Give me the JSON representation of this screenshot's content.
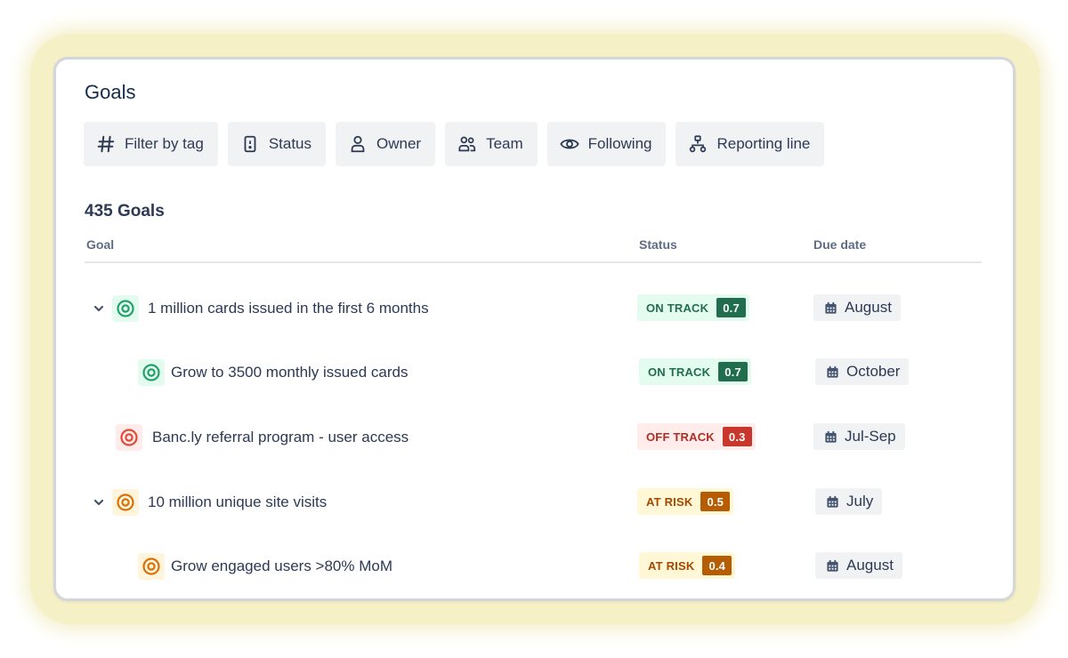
{
  "page": {
    "title": "Goals"
  },
  "filters": [
    {
      "label": "Filter by tag",
      "icon": "hash-icon"
    },
    {
      "label": "Status",
      "icon": "status-icon"
    },
    {
      "label": "Owner",
      "icon": "person-icon"
    },
    {
      "label": "Team",
      "icon": "team-icon"
    },
    {
      "label": "Following",
      "icon": "eye-icon"
    },
    {
      "label": "Reporting line",
      "icon": "hierarchy-icon"
    }
  ],
  "list": {
    "count_label": "435 Goals",
    "columns": {
      "goal": "Goal",
      "status": "Status",
      "due": "Due date"
    }
  },
  "colors": {
    "on_track_bg": "#e3fcef",
    "on_track_text": "#216e4e",
    "on_track_score": "#216e4e",
    "off_track_bg": "#ffeceb",
    "off_track_text": "#ae2e24",
    "off_track_score": "#c9372c",
    "at_risk_bg": "#fff7d6",
    "at_risk_text": "#a54800",
    "at_risk_score": "#b65c02",
    "green_icon": "#22a06b",
    "red_icon": "#e34935",
    "orange_icon": "#d97008"
  },
  "goals": [
    {
      "name": "1 million cards issued in the first 6 months",
      "status": "ON TRACK",
      "score": "0.7",
      "due": "August",
      "expandable": true,
      "level": 0
    },
    {
      "name": "Grow to 3500 monthly issued cards",
      "status": "ON TRACK",
      "score": "0.7",
      "due": "October",
      "expandable": false,
      "level": 1
    },
    {
      "name": "Banc.ly referral program - user access",
      "status": "OFF TRACK",
      "score": "0.3",
      "due": "Jul-Sep",
      "expandable": false,
      "level": 0
    },
    {
      "name": "10 million unique site visits",
      "status": "AT RISK",
      "score": "0.5",
      "due": "July",
      "expandable": true,
      "level": 0
    },
    {
      "name": "Grow engaged users >80% MoM",
      "status": "AT RISK",
      "score": "0.4",
      "due": "August",
      "expandable": false,
      "level": 1
    }
  ]
}
